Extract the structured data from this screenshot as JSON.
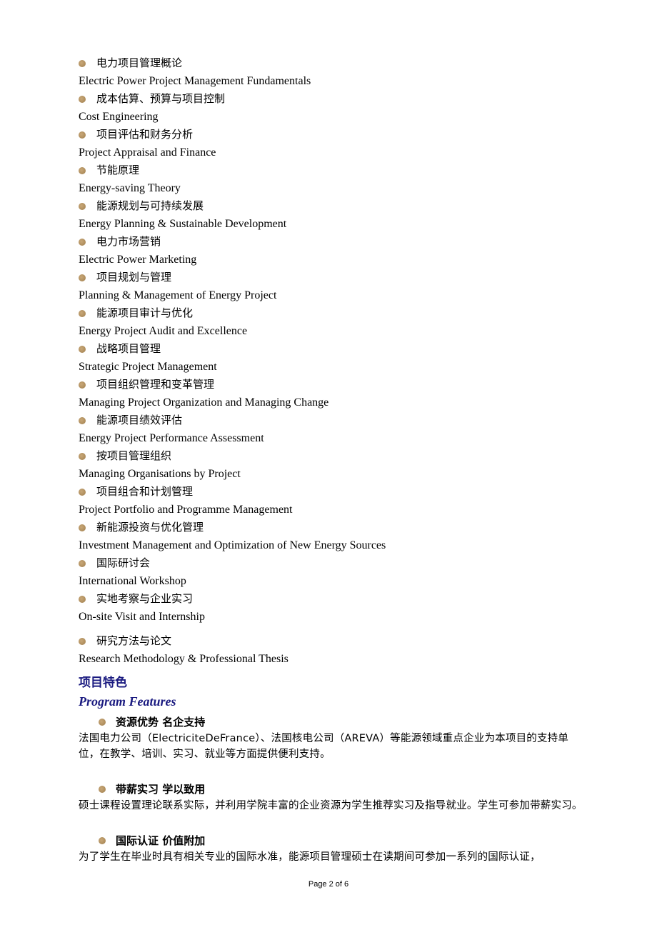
{
  "courses": [
    {
      "zh": "电力项目管理概论",
      "en": "Electric Power Project Management Fundamentals"
    },
    {
      "zh": "成本估算、预算与项目控制",
      "en": "Cost Engineering"
    },
    {
      "zh": "项目评估和财务分析",
      "en": "Project Appraisal and Finance"
    },
    {
      "zh": "节能原理",
      "en": "Energy-saving Theory"
    },
    {
      "zh": "能源规划与可持续发展",
      "en": "Energy Planning & Sustainable Development"
    },
    {
      "zh": "电力市场营销",
      "en": "Electric Power Marketing"
    },
    {
      "zh": "项目规划与管理",
      "en": "Planning & Management of Energy Project"
    },
    {
      "zh": "能源项目审计与优化",
      "en": "Energy Project Audit and Excellence"
    },
    {
      "zh": "战略项目管理",
      "en": "Strategic Project Management"
    },
    {
      "zh": "项目组织管理和变革管理",
      "en": "Managing Project Organization and Managing Change"
    },
    {
      "zh": "能源项目绩效评估",
      "en": "Energy Project Performance Assessment"
    },
    {
      "zh": "按项目管理组织",
      "en": "Managing Organisations by Project"
    },
    {
      "zh": "项目组合和计划管理",
      "en": "Project Portfolio and Programme Management"
    },
    {
      "zh": "新能源投资与优化管理",
      "en": "Investment Management and Optimization of New Energy Sources"
    },
    {
      "zh": "国际研讨会",
      "en": "International Workshop"
    },
    {
      "zh": "实地考察与企业实习",
      "en": "On-site Visit and Internship"
    },
    {
      "zh": "研究方法与论文",
      "en": "Research Methodology & Professional Thesis"
    }
  ],
  "features_section": {
    "title_zh": "项目特色",
    "title_en": "Program Features",
    "items": [
      {
        "heading": "资源优势  名企支持",
        "body": "法国电力公司（ElectriciteDeFrance）、法国核电公司（AREVA）等能源领域重点企业为本项目的支持单位，在教学、培训、实习、就业等方面提供便利支持。"
      },
      {
        "heading": "带薪实习  学以致用",
        "body": "硕士课程设置理论联系实际，并利用学院丰富的企业资源为学生推荐实习及指导就业。学生可参加带薪实习。"
      },
      {
        "heading": "国际认证  价值附加",
        "body": "为了学生在毕业时具有相关专业的国际水准，能源项目管理硕士在读期间可参加一系列的国际认证，"
      }
    ]
  },
  "footer": {
    "page_label": "Page 2 of 6"
  },
  "colors": {
    "heading": "#1a1a80",
    "bullet": "#b08f5e"
  }
}
